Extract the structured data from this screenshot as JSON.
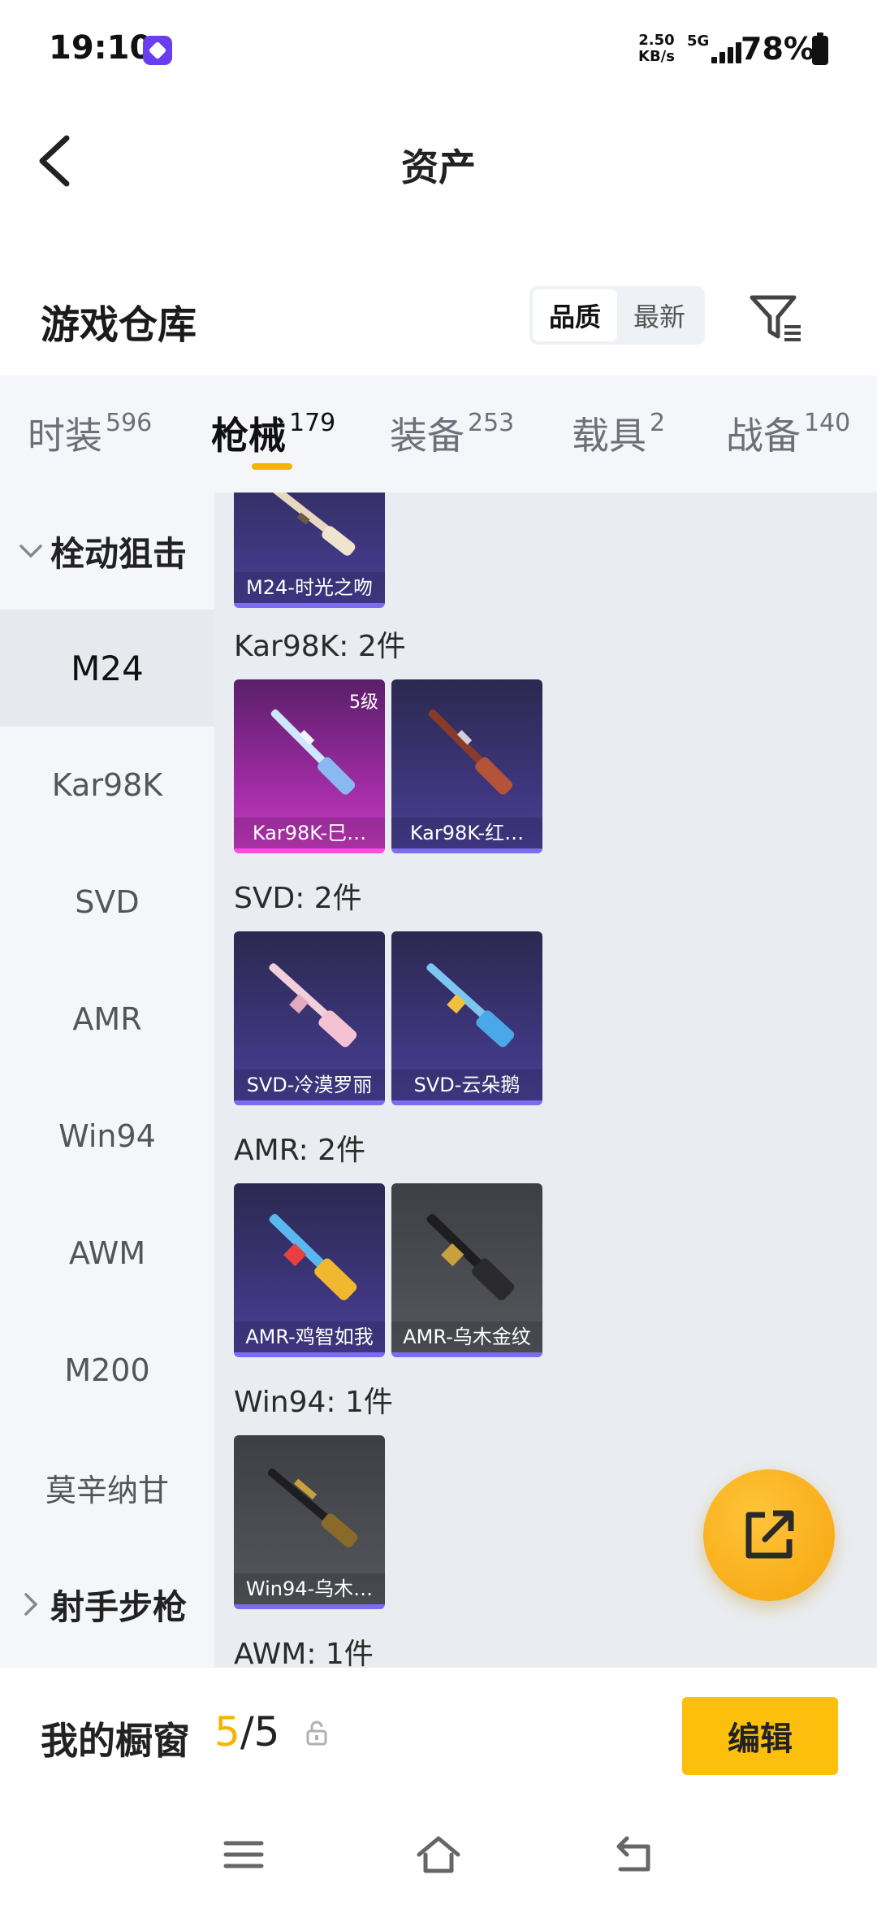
{
  "status_bar": {
    "time": "19:10",
    "speed_value": "2.50",
    "speed_unit": "KB/s",
    "network": "5G",
    "battery_percent": "78%"
  },
  "header": {
    "title": "资产",
    "back_icon": "chevron-left-icon"
  },
  "warehouse": {
    "title": "游戏仓库",
    "sort_options": [
      "品质",
      "最新"
    ],
    "sort_selected": "品质",
    "filter_icon": "filter-icon"
  },
  "tabs": [
    {
      "label": "时装",
      "count": "596"
    },
    {
      "label": "枪械",
      "count": "179"
    },
    {
      "label": "装备",
      "count": "253"
    },
    {
      "label": "载具",
      "count": "2"
    },
    {
      "label": "战备",
      "count": "140"
    }
  ],
  "active_tab": "枪械",
  "sidebar": {
    "group_expanded": "栓动狙击",
    "items": [
      "M24",
      "Kar98K",
      "SVD",
      "AMR",
      "Win94",
      "AWM",
      "M200",
      "莫辛纳甘"
    ],
    "active_item": "M24",
    "group_collapsed": "射手步枪"
  },
  "sections": [
    {
      "title": "",
      "items": [
        {
          "name": "M24-时光之吻",
          "rarity": "purple"
        }
      ]
    },
    {
      "title": "Kar98K: 2件",
      "items": [
        {
          "name": "Kar98K-巳…",
          "rarity": "pink",
          "badge": "5级"
        },
        {
          "name": "Kar98K-红…",
          "rarity": "purple"
        }
      ]
    },
    {
      "title": "SVD: 2件",
      "items": [
        {
          "name": "SVD-冷漠罗丽",
          "rarity": "purple"
        },
        {
          "name": "SVD-云朵鹅",
          "rarity": "purple"
        }
      ]
    },
    {
      "title": "AMR: 2件",
      "items": [
        {
          "name": "AMR-鸡智如我",
          "rarity": "purple"
        },
        {
          "name": "AMR-乌木金纹",
          "rarity": "gray"
        }
      ]
    },
    {
      "title": "Win94: 1件",
      "items": [
        {
          "name": "Win94-乌木…",
          "rarity": "gray"
        }
      ]
    },
    {
      "title": "AWM: 1件",
      "items": []
    }
  ],
  "fab_icon": "share-external-icon",
  "showcase": {
    "label": "我的橱窗",
    "current": "5",
    "total": "/5",
    "lock_icon": "lock-icon",
    "edit_label": "编辑"
  },
  "navbar": {
    "menu_icon": "menu-icon",
    "home_icon": "home-icon",
    "back_icon": "back-icon"
  },
  "colors": {
    "accent": "#f4b400",
    "edit_button": "#fbbf0c",
    "fab": "#f5a40c",
    "rarity_purple": "#7b6cf0",
    "rarity_pink": "#ff4be0"
  }
}
